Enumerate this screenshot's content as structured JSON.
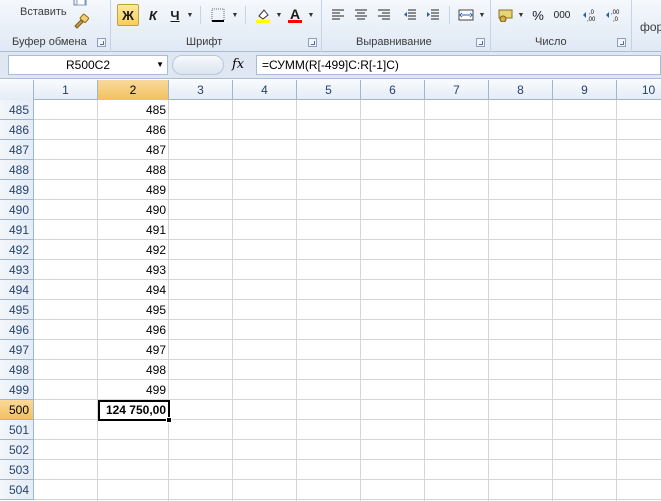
{
  "ribbon": {
    "paste_label": "Вставить",
    "groups": {
      "clipboard": "Буфер обмена",
      "font": "Шрифт",
      "alignment": "Выравнивание",
      "number": "Число",
      "styles_partial": "фор"
    },
    "font": {
      "bold": "Ж",
      "italic": "К",
      "underline": "Ч",
      "font_color_letter": "A"
    },
    "number": {
      "percent": "%",
      "thousands": "000",
      "increase_decimal": ",0\n,00",
      "decrease_decimal": ",00\n,0"
    },
    "colors": {
      "highlight": "#ffff00",
      "font_color": "#ff0000",
      "selected_button": "#f8ce5b"
    }
  },
  "formula_bar": {
    "name_box": "R500C2",
    "fx_label": "fx",
    "formula": "=СУММ(R[-499]C:R[-1]C)"
  },
  "sheet": {
    "columns": [
      "1",
      "2",
      "3",
      "4",
      "5",
      "6",
      "7",
      "8",
      "9",
      "10"
    ],
    "active_column": "2",
    "rows": [
      {
        "num": "485",
        "value": "485"
      },
      {
        "num": "486",
        "value": "486"
      },
      {
        "num": "487",
        "value": "487"
      },
      {
        "num": "488",
        "value": "488"
      },
      {
        "num": "489",
        "value": "489"
      },
      {
        "num": "490",
        "value": "490"
      },
      {
        "num": "491",
        "value": "491"
      },
      {
        "num": "492",
        "value": "492"
      },
      {
        "num": "493",
        "value": "493"
      },
      {
        "num": "494",
        "value": "494"
      },
      {
        "num": "495",
        "value": "495"
      },
      {
        "num": "496",
        "value": "496"
      },
      {
        "num": "497",
        "value": "497"
      },
      {
        "num": "498",
        "value": "498"
      },
      {
        "num": "499",
        "value": "499"
      },
      {
        "num": "500",
        "value": "124 750,00"
      },
      {
        "num": "501",
        "value": ""
      },
      {
        "num": "502",
        "value": ""
      },
      {
        "num": "503",
        "value": ""
      },
      {
        "num": "504",
        "value": ""
      }
    ],
    "active_row": "500"
  }
}
